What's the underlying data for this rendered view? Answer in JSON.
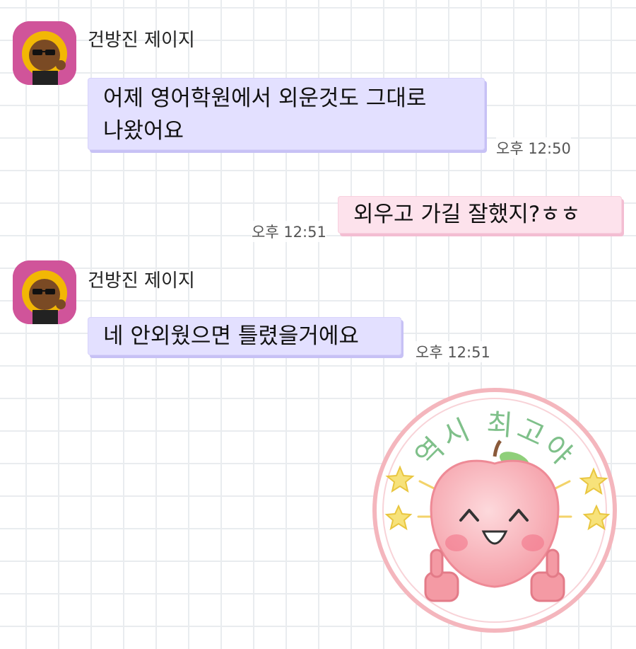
{
  "messages": [
    {
      "sender": "건방진 제이지",
      "text_line1": "어제 영어학원에서 외운것도 그대로",
      "text_line2": "나왔어요",
      "time": "오후 12:50"
    },
    {
      "text": "외우고 가길 잘했지?ㅎㅎ",
      "time": "오후 12:51"
    },
    {
      "sender": "건방진 제이지",
      "text": "네 안외웠으면 틀렸을거에요",
      "time": "오후 12:51"
    }
  ],
  "sticker": {
    "caption": "역시 최고야",
    "icon": "apple-thumbs-up-sticker"
  },
  "colors": {
    "incoming_bubble": "#e3e0ff",
    "outgoing_bubble": "#fde2ec",
    "avatar_bg": "#d0549a",
    "sticker_ring": "#f4b6bd"
  }
}
